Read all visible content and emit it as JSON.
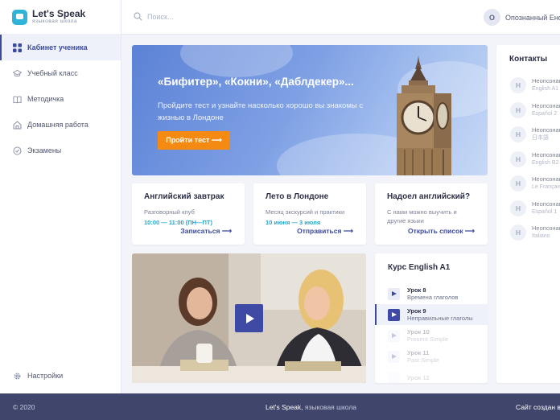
{
  "brand": {
    "name": "Let's Speak",
    "tagline": "языковая школа"
  },
  "sidebar": {
    "items": [
      {
        "label": "Кабинет ученика",
        "icon": "grid-icon",
        "active": true
      },
      {
        "label": "Учебный класс",
        "icon": "graduation-cap-icon"
      },
      {
        "label": "Методичка",
        "icon": "book-icon"
      },
      {
        "label": "Домашняя работа",
        "icon": "home-icon"
      },
      {
        "label": "Экзамены",
        "icon": "badge-icon"
      }
    ],
    "settings_label": "Настройки"
  },
  "header": {
    "search_placeholder": "Поиск...",
    "user_initial": "О",
    "user_name": "Опознанный Ено"
  },
  "hero": {
    "title": "«Бифитер», «Кокни», «Даблдекер»...",
    "text": "Пройдите тест и узнайте насколько хорошо вы знакомы с жизнью в Лондоне",
    "button": "Пройти тест ⟶"
  },
  "cards": [
    {
      "title": "Английский завтрак",
      "subtitle": "Разговорный клуб",
      "time": "10:00 — 11:00 (ПН—ПТ)",
      "link": "Записаться ⟶"
    },
    {
      "title": "Лето в Лондоне",
      "subtitle": "Месяц экскурсий и практики",
      "time": "10 июня — 3 июля",
      "link": "Отправиться ⟶"
    },
    {
      "title": "Надоел английский?",
      "subtitle": "С нами можно выучить и другие языки",
      "time": "",
      "link": "Открыть список ⟶"
    }
  ],
  "course": {
    "title": "Курс English A1",
    "lessons": [
      {
        "num": "Урок 8",
        "name": "Времена глаголов",
        "state": "normal"
      },
      {
        "num": "Урок 9",
        "name": "Неправильные глаголы",
        "state": "active"
      },
      {
        "num": "Урок 10",
        "name": "Present Simple",
        "state": "dim"
      },
      {
        "num": "Урок 11",
        "name": "Past Simple",
        "state": "dim"
      },
      {
        "num": "Урок 12",
        "name": "",
        "state": "dim"
      }
    ]
  },
  "contacts": {
    "title": "Контакты",
    "items": [
      {
        "initial": "Н",
        "name": "Неопознан",
        "lang": "English A1"
      },
      {
        "initial": "Н",
        "name": "Неопознан",
        "lang": "Español 2"
      },
      {
        "initial": "Н",
        "name": "Неопознан",
        "lang": "日本語"
      },
      {
        "initial": "Н",
        "name": "Неопознан",
        "lang": "English B2"
      },
      {
        "initial": "Н",
        "name": "Неопознан",
        "lang": "Le Français"
      },
      {
        "initial": "Н",
        "name": "Неопознан",
        "lang": "Español 1"
      },
      {
        "initial": "Н",
        "name": "Неопознан",
        "lang": "Italiano"
      }
    ]
  },
  "footer": {
    "copyright": "© 2020",
    "brand": "Let's Speak,",
    "school": " языковая школа",
    "credit": "Сайт создан в"
  },
  "colors": {
    "accent": "#3c4a9e",
    "orange": "#f58a12",
    "cyan": "#22a7c9",
    "footer": "#40456b"
  }
}
